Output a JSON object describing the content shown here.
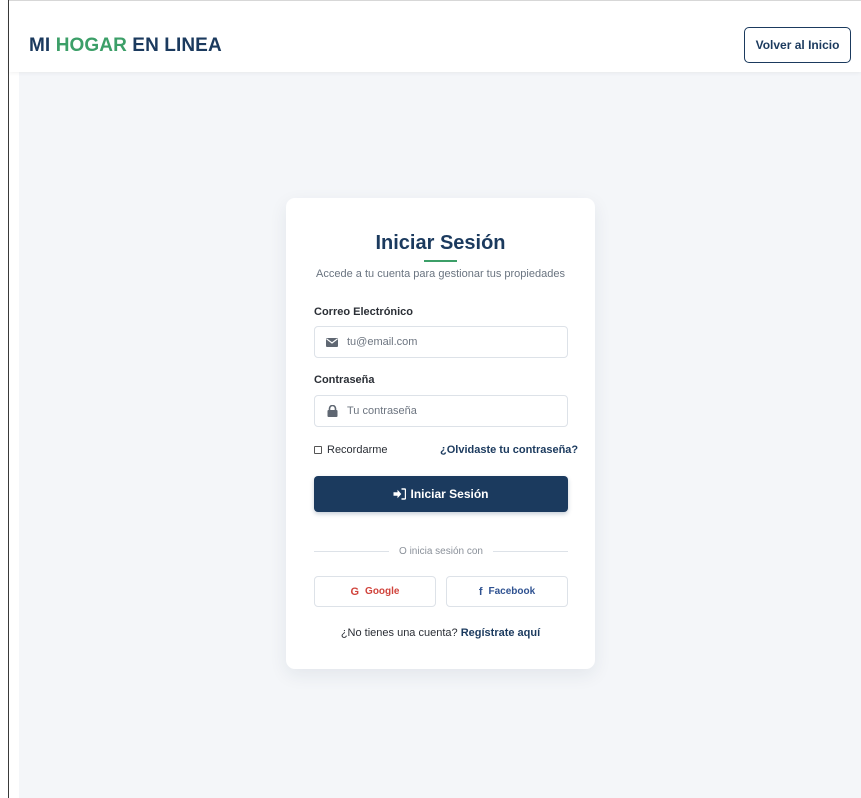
{
  "header": {
    "brand_part1": "MI ",
    "brand_part2": "HOGAR",
    "brand_part3": " EN LINEA",
    "back_button": "Volver al Inicio"
  },
  "login": {
    "title": "Iniciar Sesión",
    "subtitle": "Accede a tu cuenta para gestionar tus propiedades",
    "email_label": "Correo Electrónico",
    "email_placeholder": "tu@email.com",
    "password_label": "Contraseña",
    "password_placeholder": "Tu contraseña",
    "remember_label": "Recordarme",
    "forgot_link": "¿Olvidaste tu contraseña?",
    "submit_label": "Iniciar Sesión",
    "divider_text": "O inicia sesión con",
    "google_label": "Google",
    "facebook_label": "Facebook",
    "signup_prompt": "¿No tienes una cuenta?",
    "signup_link": "Regístrate aquí"
  },
  "icons": {
    "email": "envelope-icon",
    "password": "lock-icon",
    "submit": "sign-in-icon",
    "google": "google-icon",
    "facebook": "facebook-icon"
  },
  "colors": {
    "primary": "#1b3a5e",
    "accent": "#3c9f68",
    "google": "#d0433b",
    "facebook": "#2f5291",
    "background": "#f4f6f9"
  }
}
